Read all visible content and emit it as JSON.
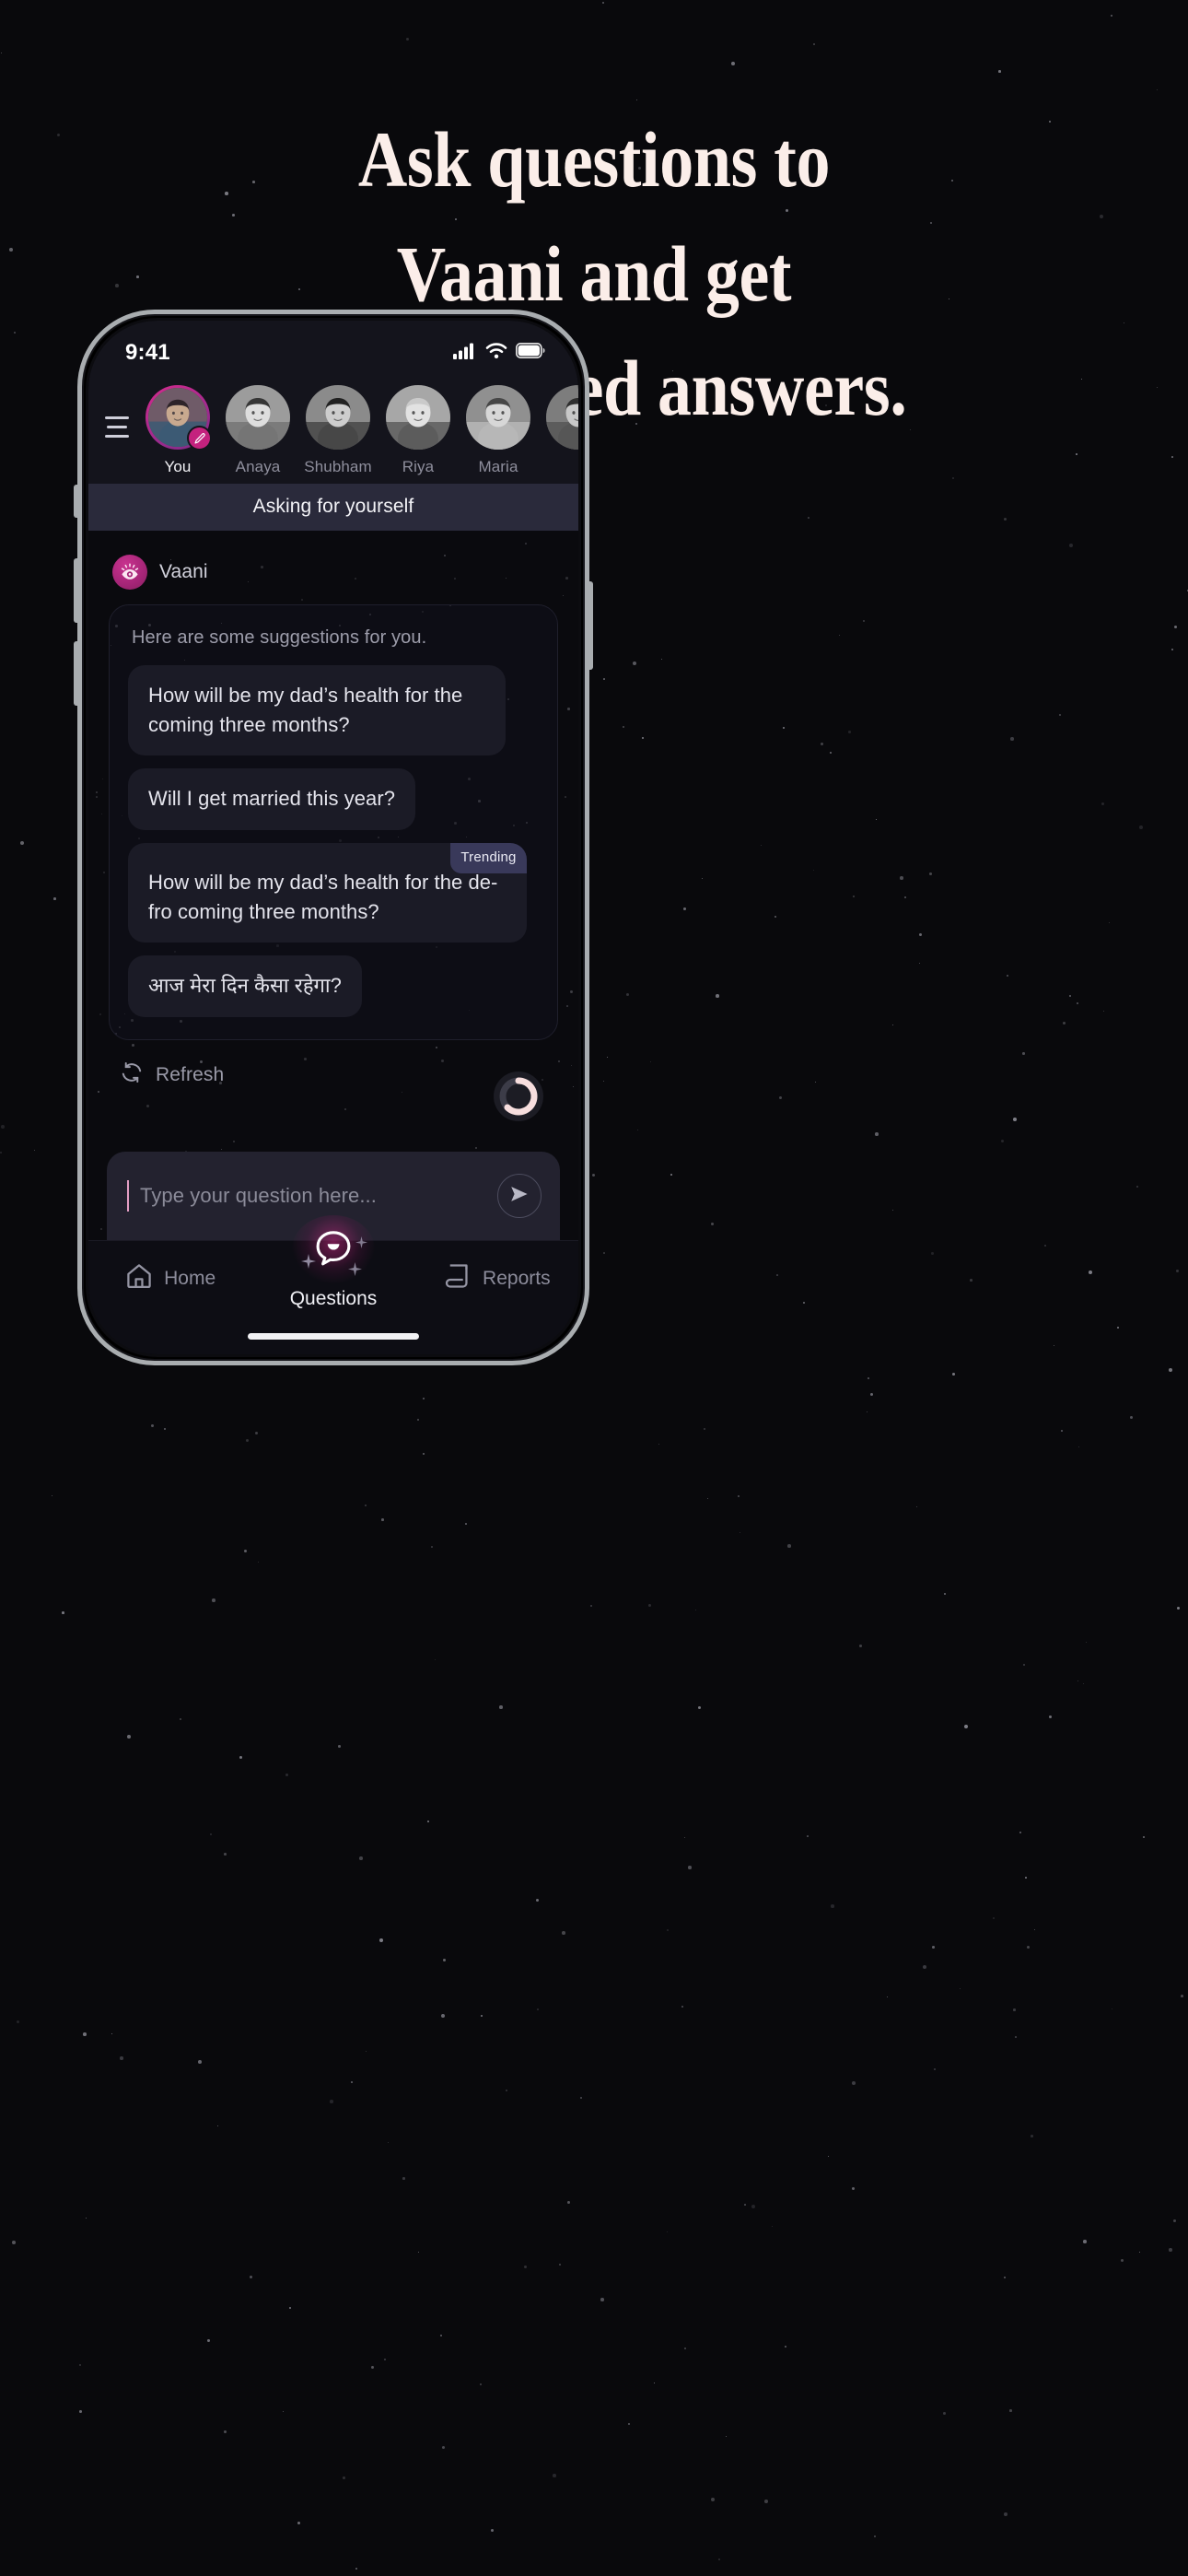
{
  "headline": "Ask questions to\nVaani and get\npersonalised answers.",
  "colors": {
    "page_background": "#09090c",
    "headline_text": "#fbeee9",
    "accent_pink": "#c4227e",
    "accent_magenta": "#d62b8c",
    "banner_background": "#2a2a3b",
    "chip_background": "#1b1b26",
    "trending_badge_background": "#39395a",
    "composer_background": "#23222f",
    "phone_frame": "#a9adb0"
  },
  "phone": {
    "status_bar": {
      "time": "9:41",
      "icons": [
        "cellular-signal-icon",
        "wifi-icon",
        "battery-icon"
      ]
    },
    "home_indicator": true
  },
  "top_bar": {
    "menu_icon": "hamburger-menu-icon",
    "people": [
      {
        "name": "You",
        "is_self": true,
        "badge_icon": "edit-pencil-icon"
      },
      {
        "name": "Anaya",
        "is_self": false
      },
      {
        "name": "Shubham",
        "is_self": false
      },
      {
        "name": "Riya",
        "is_self": false
      },
      {
        "name": "Maria",
        "is_self": false
      },
      {
        "name": "",
        "is_self": false
      }
    ]
  },
  "context_banner": {
    "label": "Asking for yourself"
  },
  "assistant": {
    "avatar_icon": "vaani-eye-icon",
    "name": "Vaani"
  },
  "suggestions": {
    "intro": "Here are some suggestions for you.",
    "chips": [
      {
        "text": "How will be my dad’s health for the coming three months?",
        "badge": null
      },
      {
        "text": "Will I get married this year?",
        "badge": null
      },
      {
        "text": "How will be my dad’s health for the de-fro coming three months?",
        "badge": "Trending"
      },
      {
        "text": "आज मेरा दिन कैसा रहेगा?",
        "badge": null
      }
    ],
    "refresh": {
      "icon": "refresh-icon",
      "label": "Refresh"
    },
    "loading_spinner": {
      "icon": "loading-spinner-icon",
      "visible": true
    }
  },
  "composer": {
    "placeholder": "Type your question here...",
    "value": "",
    "send_icon": "send-paper-plane-icon"
  },
  "bottom_nav": {
    "items": [
      {
        "label": "Home",
        "icon": "home-icon",
        "active": false
      },
      {
        "label": "Questions",
        "icon": "chat-bubble-icon",
        "active": true
      },
      {
        "label": "Reports",
        "icon": "document-icon",
        "active": false
      }
    ]
  }
}
